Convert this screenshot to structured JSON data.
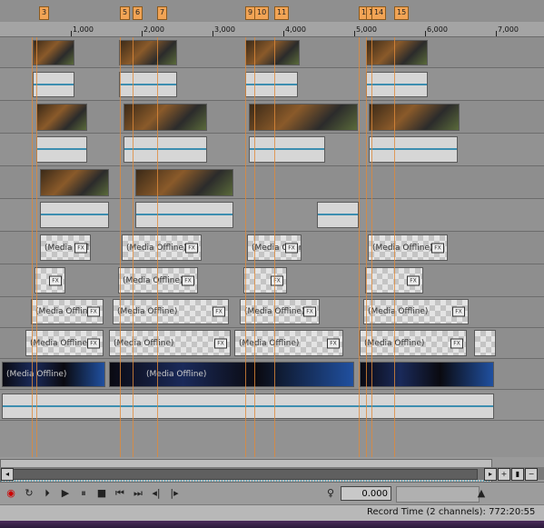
{
  "ruler": {
    "ticks": [
      "1,000",
      "2,000",
      "3,000",
      "4,000",
      "5,000",
      "6,000",
      "7,000"
    ],
    "markers": [
      "3",
      "5",
      "6",
      "7",
      "9",
      "10",
      "11",
      "1",
      "1",
      "14",
      "15"
    ]
  },
  "clips": {
    "offline_label": "(Media Offline)",
    "fx_label": "FX"
  },
  "transport": {
    "rate_value": "0.000"
  },
  "status": {
    "record_label": "Record Time (2 channels):",
    "record_value": "772:20:55"
  }
}
